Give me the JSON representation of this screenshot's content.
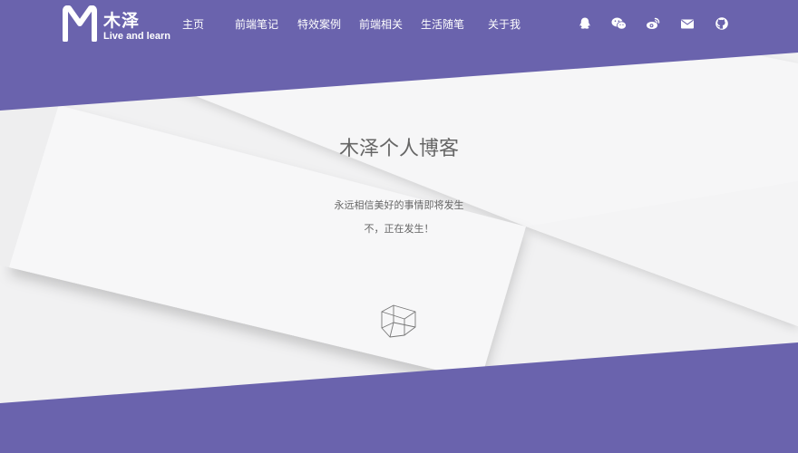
{
  "brand": {
    "name": "木泽",
    "tagline": "Live and learn"
  },
  "nav": [
    {
      "label": "主页"
    },
    {
      "label": "前端笔记"
    },
    {
      "label": "特效案例"
    },
    {
      "label": "前端相关"
    },
    {
      "label": "生活随笔"
    },
    {
      "label": "关于我"
    }
  ],
  "social_icons": [
    "qq-icon",
    "wechat-icon",
    "weibo-icon",
    "email-icon",
    "github-icon"
  ],
  "hero": {
    "title": "木泽个人博客",
    "line1": "永远相信美好的事情即将发生",
    "line2": "不，正在发生！"
  },
  "colors": {
    "primary": "#6a63ad",
    "paper": "#f2f2f3",
    "text": "#666666"
  }
}
